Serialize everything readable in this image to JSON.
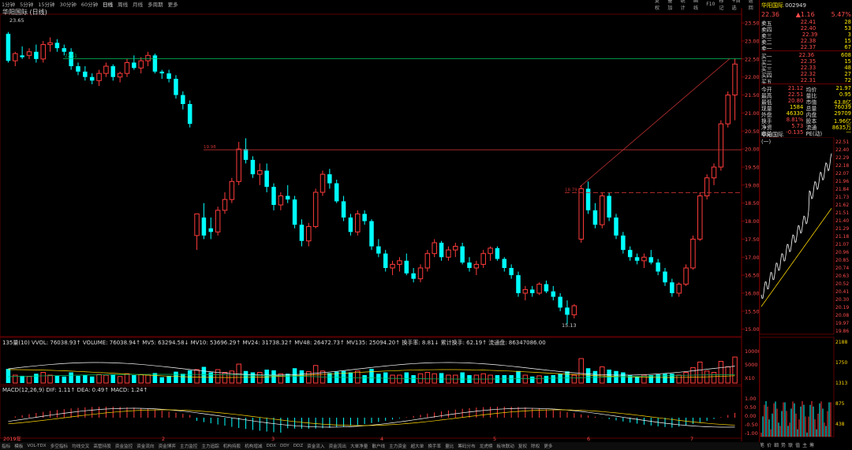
{
  "period_tabs": [
    "1分钟",
    "5分钟",
    "15分钟",
    "30分钟",
    "60分钟",
    "日线",
    "周线",
    "月线",
    "多周期",
    "更多"
  ],
  "active_period_index": 5,
  "right_tools": [
    "复权",
    "叠加",
    "统计",
    "画线",
    "F10",
    "标记",
    "+自选",
    "返回"
  ],
  "chart_title": "华阳国际 (日线)",
  "price_axis": [
    "23.50",
    "23.00",
    "22.50",
    "22.00",
    "21.50",
    "21.00",
    "20.50",
    "20.00",
    "19.50",
    "19.00",
    "18.50",
    "18.00",
    "17.50",
    "17.00",
    "16.50",
    "16.00",
    "15.50",
    "15.00"
  ],
  "high_label": "23.65",
  "low_label": "15.13",
  "hline_labels": [
    "22.51",
    "19.98",
    "18.79"
  ],
  "vol_indicator": "135量(10) VVOL: 76038.93↑ VOLUME: 76038.94↑ MV5: 63294.58↓ MV10: 53696.29↑ MV24: 31738.32↑ MV48: 26472.73↑ MV135: 25094.20↑ 换手率: 8.81↓ 累计换手: 62.19↑ 流通盘: 86347086.00",
  "vol_axis": [
    "10000",
    "5000",
    "X10"
  ],
  "macd_indicator": "MACD(12,26,9) DIF: 1.11↑ DEA: 0.49↑ MACD: 1.24↑",
  "macd_axis": [
    "1.00",
    "0.50",
    "0.00",
    "-0.50",
    "-1.00"
  ],
  "time_labels": [
    "2019年",
    "2",
    "3",
    "4",
    "5",
    "6",
    "7"
  ],
  "right_panel": {
    "code_name": "华阳国际",
    "code": "002949",
    "price": "22.36",
    "change": "▲1.16",
    "pct": "5.47%",
    "asks": [
      {
        "label": "卖五",
        "price": "22.41",
        "vol": "28"
      },
      {
        "label": "卖四",
        "price": "22.40",
        "vol": "53"
      },
      {
        "label": "卖三",
        "price": "22.39",
        "vol": "3"
      },
      {
        "label": "卖二",
        "price": "22.38",
        "vol": "15"
      },
      {
        "label": "卖一",
        "price": "22.37",
        "vol": "67"
      }
    ],
    "bids": [
      {
        "label": "买一",
        "price": "22.36",
        "vol": "608"
      },
      {
        "label": "买二",
        "price": "22.35",
        "vol": "15"
      },
      {
        "label": "买三",
        "price": "22.33",
        "vol": "48"
      },
      {
        "label": "买四",
        "price": "22.32",
        "vol": "27"
      },
      {
        "label": "买五",
        "price": "22.31",
        "vol": "72"
      }
    ],
    "stats": [
      [
        "今开",
        "21.12",
        "均价",
        "21.97"
      ],
      [
        "最高",
        "22.51",
        "量比",
        "0.95"
      ],
      [
        "最低",
        "20.80",
        "市值",
        "43.8亿"
      ],
      [
        "现量",
        "1584",
        "总量",
        "76039"
      ],
      [
        "外盘",
        "46330",
        "内盘",
        "29709"
      ],
      [
        "换手",
        "8.81%",
        "股本",
        "1.96亿"
      ],
      [
        "净资",
        "5.73",
        "流通",
        "8635万"
      ],
      [
        "收益(一)",
        "-0.135",
        "PE(动)",
        "—"
      ]
    ],
    "mini_title": "华阳国际",
    "mini_axis": [
      "22.51",
      "22.40",
      "22.29",
      "22.18",
      "22.07",
      "21.96",
      "21.84",
      "21.73",
      "21.62",
      "21.51",
      "21.40",
      "21.29",
      "21.18",
      "21.07",
      "20.96",
      "20.85",
      "20.74",
      "20.63",
      "20.52",
      "20.41",
      "20.30",
      "20.19",
      "20.08",
      "19.97",
      "19.86"
    ],
    "mini_vol_axis": [
      "2188",
      "1750",
      "1313",
      "875",
      "438"
    ],
    "bottom_tabs": [
      "笔",
      "价",
      "细",
      "势",
      "联",
      "值",
      "主",
      "筹"
    ]
  },
  "bottom_tabs": [
    "指标",
    "模板",
    "VOL-TDX",
    "多空指标",
    "均线交叉",
    "高管持股",
    "资金监控",
    "资金流向",
    "资金博弈",
    "主力监控",
    "主力追踪",
    "机构持股",
    "机构增减",
    "DDX",
    "DDY",
    "DDZ",
    "资金流入",
    "资金流出",
    "大单净量",
    "散户线",
    "主力资金",
    "超大单",
    "换手率",
    "量比",
    "筹码分布",
    "龙虎榜",
    "板块联动",
    "复权",
    "除权",
    "更多"
  ],
  "candles": [
    [
      23.2,
      23.25,
      22.4,
      22.45
    ],
    [
      22.45,
      22.7,
      22.3,
      22.65
    ],
    [
      22.6,
      22.85,
      22.5,
      22.55
    ],
    [
      22.6,
      22.8,
      22.5,
      22.7
    ],
    [
      22.7,
      22.9,
      22.4,
      22.5
    ],
    [
      22.5,
      23.0,
      22.4,
      22.9
    ],
    [
      22.9,
      23.1,
      22.7,
      22.95
    ],
    [
      22.95,
      23.05,
      22.7,
      22.8
    ],
    [
      22.8,
      22.9,
      22.6,
      22.7
    ],
    [
      22.7,
      22.8,
      22.2,
      22.3
    ],
    [
      22.3,
      22.4,
      22.05,
      22.15
    ],
    [
      22.15,
      22.3,
      21.9,
      22.0
    ],
    [
      22.0,
      22.1,
      21.8,
      21.9
    ],
    [
      21.9,
      22.2,
      21.75,
      22.1
    ],
    [
      22.1,
      22.4,
      22.0,
      22.3
    ],
    [
      22.3,
      22.35,
      21.9,
      22.0
    ],
    [
      22.0,
      22.15,
      21.85,
      22.1
    ],
    [
      22.1,
      22.5,
      22.0,
      22.4
    ],
    [
      22.4,
      22.6,
      22.2,
      22.25
    ],
    [
      22.25,
      22.55,
      22.1,
      22.45
    ],
    [
      22.45,
      22.7,
      22.3,
      22.6
    ],
    [
      22.6,
      22.65,
      22.1,
      22.15
    ],
    [
      22.15,
      22.2,
      21.95,
      22.1
    ],
    [
      22.1,
      22.2,
      21.85,
      21.95
    ],
    [
      21.95,
      22.05,
      21.4,
      21.5
    ],
    [
      21.5,
      21.6,
      21.1,
      21.25
    ],
    [
      21.25,
      21.35,
      20.6,
      20.7
    ],
    [
      17.6,
      18.0,
      17.2,
      18.2
    ],
    [
      18.1,
      18.5,
      17.5,
      17.6
    ],
    [
      17.8,
      18.1,
      17.5,
      17.7
    ],
    [
      17.7,
      18.4,
      17.6,
      18.3
    ],
    [
      18.3,
      18.8,
      18.2,
      18.6
    ],
    [
      18.6,
      19.2,
      18.5,
      19.1
    ],
    [
      19.1,
      20.2,
      19.0,
      20.0
    ],
    [
      20.0,
      20.3,
      19.6,
      19.7
    ],
    [
      19.7,
      19.8,
      19.2,
      19.3
    ],
    [
      19.3,
      19.6,
      19.0,
      19.4
    ],
    [
      19.4,
      19.6,
      18.8,
      18.95
    ],
    [
      18.95,
      19.05,
      18.3,
      18.45
    ],
    [
      18.45,
      18.8,
      18.3,
      18.7
    ],
    [
      18.7,
      19.0,
      18.5,
      18.6
    ],
    [
      18.6,
      18.7,
      17.8,
      17.9
    ],
    [
      17.9,
      18.05,
      17.3,
      17.45
    ],
    [
      17.45,
      17.95,
      17.3,
      17.85
    ],
    [
      17.85,
      18.9,
      17.8,
      18.8
    ],
    [
      18.8,
      19.4,
      18.7,
      19.3
    ],
    [
      19.3,
      19.45,
      18.9,
      19.05
    ],
    [
      19.05,
      19.15,
      18.5,
      18.55
    ],
    [
      18.55,
      18.7,
      18.0,
      18.1
    ],
    [
      18.1,
      18.2,
      17.6,
      17.7
    ],
    [
      17.7,
      18.3,
      17.6,
      18.2
    ],
    [
      18.2,
      18.3,
      17.9,
      18.0
    ],
    [
      18.0,
      18.05,
      17.2,
      17.3
    ],
    [
      17.3,
      17.5,
      17.0,
      17.1
    ],
    [
      17.1,
      17.2,
      16.6,
      16.7
    ],
    [
      16.7,
      16.9,
      16.5,
      16.8
    ],
    [
      16.8,
      17.0,
      16.6,
      16.9
    ],
    [
      16.9,
      17.1,
      16.5,
      16.55
    ],
    [
      16.55,
      16.7,
      16.3,
      16.4
    ],
    [
      16.4,
      16.8,
      16.3,
      16.7
    ],
    [
      16.7,
      17.2,
      16.6,
      17.1
    ],
    [
      17.1,
      17.5,
      17.0,
      17.4
    ],
    [
      17.4,
      17.45,
      16.9,
      17.0
    ],
    [
      17.0,
      17.3,
      16.9,
      17.2
    ],
    [
      17.2,
      17.4,
      17.0,
      17.3
    ],
    [
      17.3,
      17.4,
      16.8,
      16.85
    ],
    [
      16.85,
      17.0,
      16.6,
      16.7
    ],
    [
      16.7,
      16.9,
      16.5,
      16.8
    ],
    [
      16.8,
      17.2,
      16.7,
      17.1
    ],
    [
      17.1,
      17.3,
      16.9,
      17.25
    ],
    [
      17.25,
      17.3,
      16.9,
      16.95
    ],
    [
      16.95,
      17.0,
      16.6,
      16.7
    ],
    [
      16.7,
      16.8,
      16.4,
      16.5
    ],
    [
      16.5,
      16.6,
      15.9,
      16.0
    ],
    [
      16.0,
      16.2,
      15.8,
      16.1
    ],
    [
      16.1,
      16.2,
      15.9,
      16.0
    ],
    [
      16.0,
      16.3,
      15.95,
      16.25
    ],
    [
      16.25,
      16.35,
      16.0,
      16.05
    ],
    [
      16.05,
      16.2,
      15.8,
      15.9
    ],
    [
      15.9,
      16.0,
      15.5,
      15.6
    ],
    [
      15.6,
      15.8,
      15.13,
      15.4
    ],
    [
      15.4,
      15.7,
      15.3,
      15.65
    ],
    [
      17.5,
      19.0,
      17.4,
      18.9
    ],
    [
      18.9,
      19.1,
      18.2,
      18.3
    ],
    [
      18.3,
      18.5,
      17.8,
      17.9
    ],
    [
      17.9,
      18.8,
      17.8,
      18.7
    ],
    [
      18.7,
      18.8,
      18.0,
      18.1
    ],
    [
      18.1,
      18.2,
      17.5,
      17.6
    ],
    [
      17.6,
      17.7,
      17.1,
      17.2
    ],
    [
      17.2,
      17.3,
      16.9,
      17.0
    ],
    [
      17.0,
      17.1,
      16.8,
      16.9
    ],
    [
      16.9,
      17.1,
      16.7,
      17.0
    ],
    [
      17.0,
      17.2,
      16.8,
      16.85
    ],
    [
      16.85,
      16.95,
      16.5,
      16.6
    ],
    [
      16.6,
      16.7,
      16.2,
      16.3
    ],
    [
      16.3,
      16.4,
      15.9,
      16.0
    ],
    [
      16.0,
      16.3,
      15.9,
      16.25
    ],
    [
      16.25,
      16.8,
      16.2,
      16.7
    ],
    [
      16.7,
      17.6,
      16.65,
      17.5
    ],
    [
      17.5,
      18.8,
      17.45,
      18.7
    ],
    [
      18.7,
      19.3,
      18.6,
      19.2
    ],
    [
      19.2,
      19.6,
      19.0,
      19.5
    ],
    [
      19.5,
      20.8,
      19.4,
      20.7
    ],
    [
      20.7,
      21.6,
      20.6,
      21.5
    ],
    [
      21.5,
      22.51,
      20.8,
      22.36
    ]
  ]
}
